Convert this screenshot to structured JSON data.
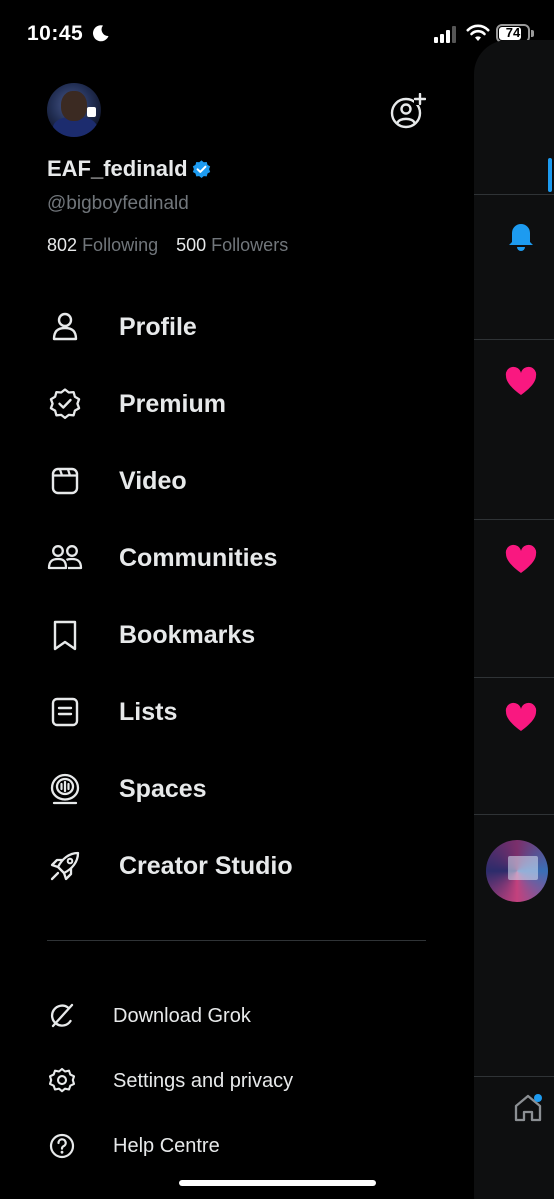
{
  "status_bar": {
    "time": "10:45",
    "battery": "74"
  },
  "account": {
    "display_name": "EAF_fedinald",
    "handle": "@bigboyfedinald",
    "following_count": "802",
    "following_label": "Following",
    "followers_count": "500",
    "followers_label": "Followers",
    "verified_color": "#1d9bf0"
  },
  "menu": [
    {
      "label": "Profile",
      "icon": "person-icon"
    },
    {
      "label": "Premium",
      "icon": "verified-badge-icon"
    },
    {
      "label": "Video",
      "icon": "video-icon"
    },
    {
      "label": "Communities",
      "icon": "communities-icon"
    },
    {
      "label": "Bookmarks",
      "icon": "bookmark-icon"
    },
    {
      "label": "Lists",
      "icon": "list-icon"
    },
    {
      "label": "Spaces",
      "icon": "spaces-icon"
    },
    {
      "label": "Creator Studio",
      "icon": "rocket-icon"
    }
  ],
  "secondary_menu": [
    {
      "label": "Download Grok",
      "icon": "grok-icon"
    },
    {
      "label": "Settings and privacy",
      "icon": "settings-icon"
    },
    {
      "label": "Help Centre",
      "icon": "help-icon"
    }
  ],
  "colors": {
    "background": "#000000",
    "text_primary": "#e7e9ea",
    "text_secondary": "#71767b",
    "accent": "#1d9bf0",
    "like": "#f91880"
  }
}
